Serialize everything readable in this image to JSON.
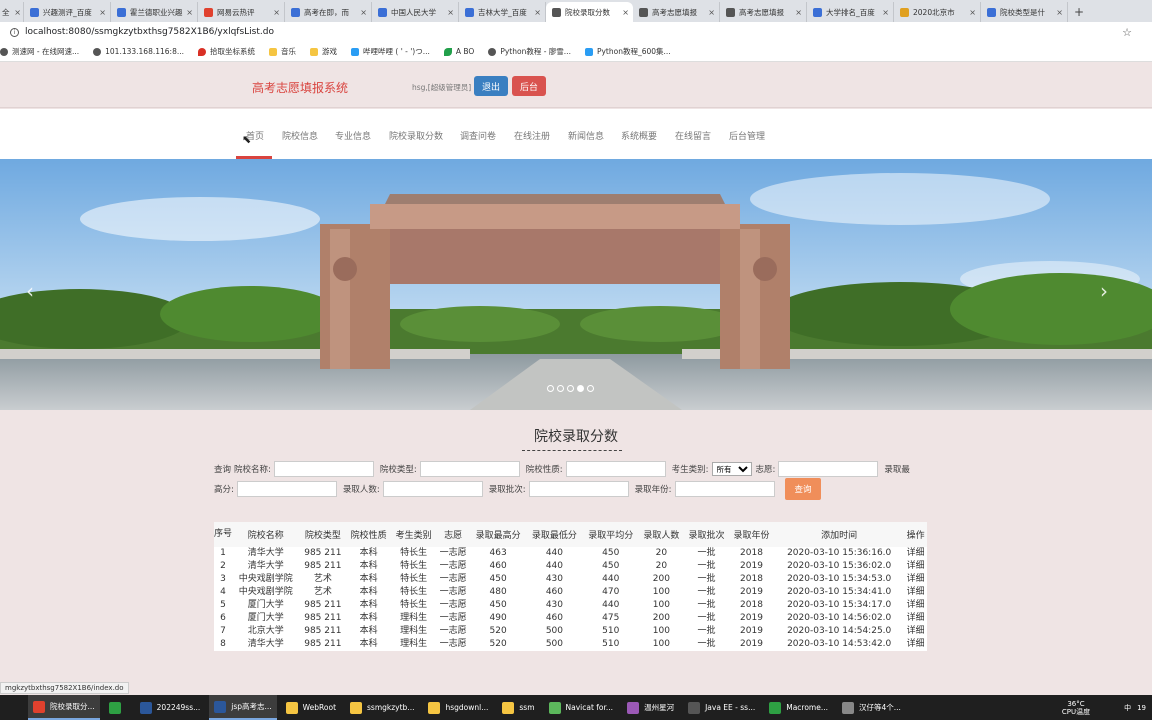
{
  "browser": {
    "tabs": [
      {
        "label": "全",
        "active": false,
        "color": "#3b6fd6"
      },
      {
        "label": "兴趣测评_百度",
        "active": false,
        "color": "#3b6fd6"
      },
      {
        "label": "霍兰德职业兴趣",
        "active": false,
        "color": "#3b6fd6"
      },
      {
        "label": "网易云热评",
        "active": false,
        "color": "#e0412e"
      },
      {
        "label": "高考在即，而",
        "active": false,
        "color": "#3b6fd6"
      },
      {
        "label": "中国人民大学",
        "active": false,
        "color": "#3b6fd6"
      },
      {
        "label": "吉林大学_百度",
        "active": false,
        "color": "#3b6fd6"
      },
      {
        "label": "院校录取分数",
        "active": true,
        "color": "#555555"
      },
      {
        "label": "高考志愿填报",
        "active": false,
        "color": "#555555"
      },
      {
        "label": "高考志愿填报",
        "active": false,
        "color": "#555555"
      },
      {
        "label": "大学排名_百度",
        "active": false,
        "color": "#3b6fd6"
      },
      {
        "label": "2020北京市",
        "active": false,
        "color": "#e0a020"
      },
      {
        "label": "院校类型是什",
        "active": false,
        "color": "#3b6fd6"
      }
    ],
    "new_tab": "+",
    "url": "localhost:8080/ssmgkzytbxthsg7582X1B6/yxlqfsList.do",
    "bookmarks": [
      {
        "label": "测速网 - 在线网速...",
        "icon": "globe"
      },
      {
        "label": "101.133.168.116:8...",
        "icon": "globe"
      },
      {
        "label": "拾取坐标系统",
        "icon": "pin"
      },
      {
        "label": "音乐",
        "icon": "folder"
      },
      {
        "label": "游戏",
        "icon": "folder"
      },
      {
        "label": "哔哩哔哩 ( ' - ')つ...",
        "icon": "tv"
      },
      {
        "label": "A BO",
        "icon": "leaf"
      },
      {
        "label": "Python教程 - 廖雪...",
        "icon": "globe"
      },
      {
        "label": "Python教程_600集...",
        "icon": "tv"
      }
    ]
  },
  "header": {
    "site_title": "高考志愿填报系统",
    "user": "hsg,[超级管理员]",
    "logout": "退出",
    "admin": "后台"
  },
  "nav": {
    "items": [
      "首页",
      "院校信息",
      "专业信息",
      "院校录取分数",
      "调查问卷",
      "在线注册",
      "新闻信息",
      "系统概要",
      "在线留言",
      "后台管理"
    ],
    "active_index": 0
  },
  "banner": {
    "prev": "‹",
    "next": "›",
    "slide_count": 5,
    "active_slide": 3
  },
  "search": {
    "title": "院校录取分数",
    "query_label": "查询",
    "fields": {
      "school_name": "院校名称:",
      "school_type": "院校类型:",
      "school_nature": "院校性质:",
      "student_type": "考生类别:",
      "student_type_value": "所有",
      "wish": "志愿:",
      "max_score_a": "录取最",
      "max_score_b": "高分:",
      "count": "录取人数:",
      "batch": "录取批次:",
      "year": "录取年份:"
    },
    "button": "查询"
  },
  "table": {
    "headers": [
      "序号",
      "院校名称",
      "院校类型",
      "院校性质",
      "考生类别",
      "志愿",
      "录取最高分",
      "录取最低分",
      "录取平均分",
      "录取人数",
      "录取批次",
      "录取年份",
      "添加时间",
      "操作"
    ],
    "rows": [
      [
        "1",
        "清华大学",
        "985 211",
        "本科",
        "特长生",
        "一志愿",
        "463",
        "440",
        "450",
        "20",
        "一批",
        "2018",
        "2020-03-10 15:36:16.0",
        "详细"
      ],
      [
        "2",
        "清华大学",
        "985 211",
        "本科",
        "特长生",
        "一志愿",
        "460",
        "440",
        "450",
        "20",
        "一批",
        "2019",
        "2020-03-10 15:36:02.0",
        "详细"
      ],
      [
        "3",
        "中央戏剧学院",
        "艺术",
        "本科",
        "特长生",
        "一志愿",
        "450",
        "430",
        "440",
        "200",
        "一批",
        "2018",
        "2020-03-10 15:34:53.0",
        "详细"
      ],
      [
        "4",
        "中央戏剧学院",
        "艺术",
        "本科",
        "特长生",
        "一志愿",
        "480",
        "460",
        "470",
        "100",
        "一批",
        "2019",
        "2020-03-10 15:34:41.0",
        "详细"
      ],
      [
        "5",
        "厦门大学",
        "985 211",
        "本科",
        "特长生",
        "一志愿",
        "450",
        "430",
        "440",
        "100",
        "一批",
        "2018",
        "2020-03-10 15:34:17.0",
        "详细"
      ],
      [
        "6",
        "厦门大学",
        "985 211",
        "本科",
        "理科生",
        "一志愿",
        "490",
        "460",
        "475",
        "200",
        "一批",
        "2019",
        "2020-03-10 14:56:02.0",
        "详细"
      ],
      [
        "7",
        "北京大学",
        "985 211",
        "本科",
        "理科生",
        "一志愿",
        "520",
        "500",
        "510",
        "100",
        "一批",
        "2019",
        "2020-03-10 14:54:25.0",
        "详细"
      ],
      [
        "8",
        "清华大学",
        "985 211",
        "本科",
        "理科生",
        "一志愿",
        "520",
        "500",
        "510",
        "100",
        "一批",
        "2019",
        "2020-03-10 14:53:42.0",
        "详细"
      ]
    ]
  },
  "status_url": "mgkzytbxthsg7582X1B6/index.do",
  "taskbar": {
    "items": [
      {
        "label": "院校录取分...",
        "color": "#e0412e",
        "active": true
      },
      {
        "label": "",
        "color": "#2ea043",
        "active": false
      },
      {
        "label": "202249ss...",
        "color": "#2b579a",
        "active": false
      },
      {
        "label": "jsp高考志...",
        "color": "#2b579a",
        "active": true
      },
      {
        "label": "WebRoot",
        "color": "#f5c542",
        "active": false
      },
      {
        "label": "ssmgkzytb...",
        "color": "#f5c542",
        "active": false
      },
      {
        "label": "hsgdownl...",
        "color": "#f5c542",
        "active": false
      },
      {
        "label": "ssm",
        "color": "#f5c542",
        "active": false
      },
      {
        "label": "Navicat for...",
        "color": "#5cb85c",
        "active": false
      },
      {
        "label": "温州星河",
        "color": "#9b59b6",
        "active": false
      },
      {
        "label": "Java EE - ss...",
        "color": "#555555",
        "active": false
      },
      {
        "label": "Macrome...",
        "color": "#2ea043",
        "active": false
      },
      {
        "label": "汉仔等4个...",
        "color": "#888888",
        "active": false
      }
    ],
    "temp_value": "36°C",
    "temp_label": "CPU温度",
    "lang": "中",
    "clock": "19"
  }
}
